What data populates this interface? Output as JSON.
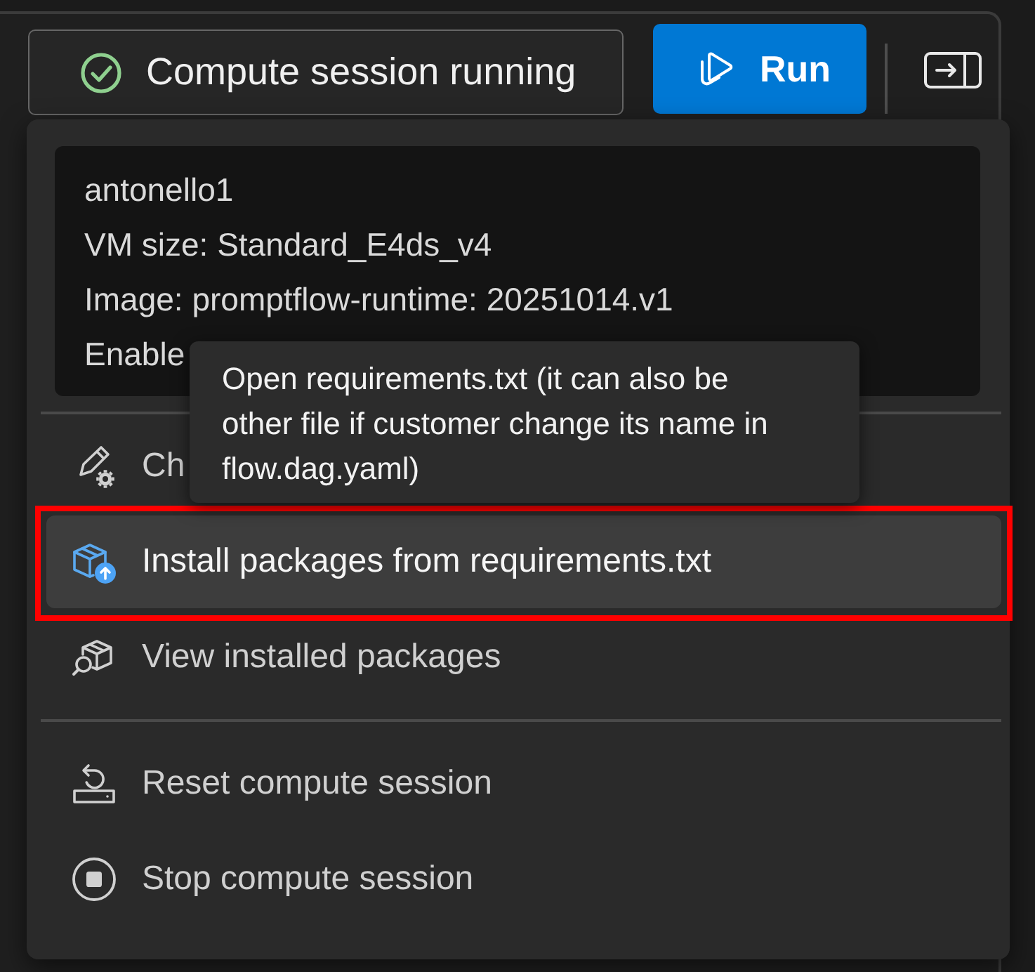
{
  "toolbar": {
    "status": {
      "label": "Compute session running",
      "running": true
    },
    "run_button": {
      "label": "Run"
    }
  },
  "menu": {
    "info": [
      "antonello1",
      "VM size: Standard_E4ds_v4",
      "Image: promptflow-runtime: 20251014.v1",
      "Enable"
    ],
    "sections": [
      {
        "items": [
          {
            "label": "Ch",
            "selected": false,
            "outlined": false
          },
          {
            "label": "Install packages from requirements.txt",
            "selected": true,
            "outlined": true
          },
          {
            "label": "View installed packages",
            "selected": false,
            "outlined": false
          }
        ]
      },
      {
        "items": [
          {
            "label": "Reset compute session",
            "selected": false,
            "outlined": false
          },
          {
            "label": "Stop compute session",
            "selected": false,
            "outlined": false
          }
        ]
      }
    ],
    "tooltip": {
      "text": "Open requirements.txt (it can also be other file if customer change its name in flow.dag.yaml)"
    }
  }
}
